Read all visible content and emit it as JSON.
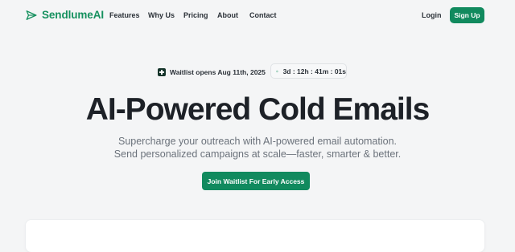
{
  "nav": {
    "brand": "SendlumeAI",
    "links": [
      "Features",
      "Why Us",
      "Pricing",
      "About",
      "Contact"
    ],
    "login": "Login",
    "signup": "Sign Up"
  },
  "announcement": {
    "waitlist_text": "Waitlist opens Aug 11th, 2025",
    "countdown": "3d : 12h : 41m : 01s"
  },
  "hero": {
    "title": "AI-Powered Cold Emails",
    "subtitle_line1": "Supercharge your outreach with AI-powered email automation.",
    "subtitle_line2": "Send personalized campaigns at scale—faster, smarter & better.",
    "cta": "Join Waitlist For Early Access"
  },
  "theme": {
    "accent": "#118a5e",
    "background": "#f4f5f6"
  },
  "icons": {
    "logo": "paper-plane-icon",
    "waitlist": "plus-square-icon",
    "countdown": "clock-icon"
  }
}
